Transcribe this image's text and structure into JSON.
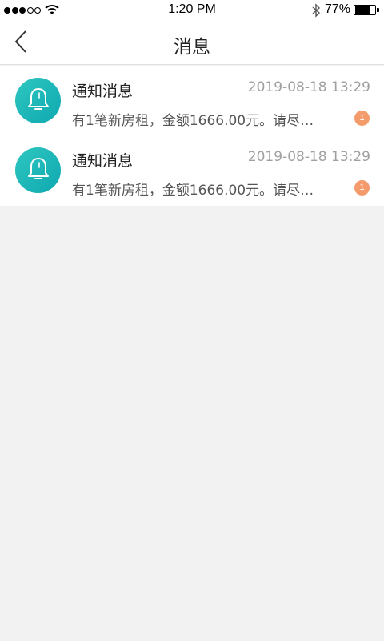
{
  "status_bar": {
    "time": "1:20 PM",
    "battery_percent": "77%",
    "battery_level": 0.77,
    "signal_strength": 3,
    "signal_max": 5
  },
  "nav": {
    "title": "消息",
    "back_icon": "chevron-left-icon"
  },
  "messages": [
    {
      "icon": "bell-icon",
      "title": "通知消息",
      "time": "2019-08-18 13:29",
      "preview": "有1笔新房租，金额1666.00元。请尽…",
      "unread": "1"
    },
    {
      "icon": "bell-icon",
      "title": "通知消息",
      "time": "2019-08-18 13:29",
      "preview": "有1笔新房租，金额1666.00元。请尽…",
      "unread": "1"
    }
  ],
  "colors": {
    "avatar_gradient_start": "#2ec7c0",
    "avatar_gradient_end": "#0fa8b0",
    "badge": "#f49b6c",
    "background": "#f2f2f2"
  }
}
